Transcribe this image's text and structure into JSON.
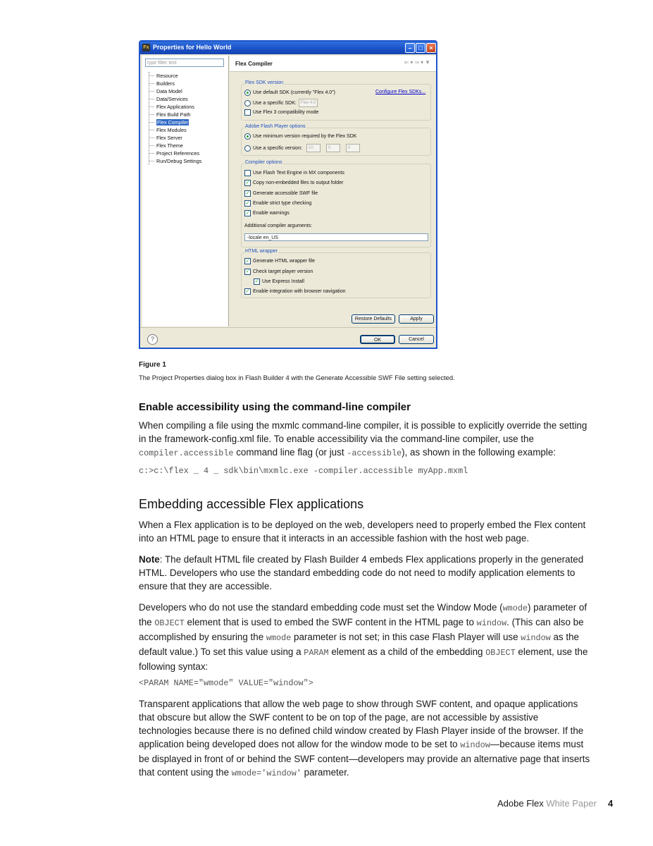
{
  "dialog": {
    "title": "Properties for Hello World",
    "app_icon": "Fx",
    "filter_placeholder": "type filter text",
    "tree_items": [
      "Resource",
      "Builders",
      "Data Model",
      "Data/Services",
      "Flex Applications",
      "Flex Build Path",
      "Flex Compiler",
      "Flex Modules",
      "Flex Server",
      "Flex Theme",
      "Project References",
      "Run/Debug Settings"
    ],
    "selected_item": "Flex Compiler",
    "page_title": "Flex Compiler",
    "sdk_group": {
      "label": "Flex SDK version",
      "use_default": "Use default SDK (currently \"Flex 4.0\")",
      "configure_link": "Configure Flex SDKs...",
      "use_specific": "Use a specific SDK:",
      "specific_value": "Flex 4.0",
      "flex3": "Use Flex 3 compatibility mode"
    },
    "player_group": {
      "label": "Adobe Flash Player options",
      "use_min": "Use minimum version required by the Flex SDK",
      "use_specific": "Use a specific version:",
      "v1": "10",
      "v2": "0",
      "v3": "0"
    },
    "compiler_group": {
      "label": "Compiler options",
      "opt1": "Use Flash Text Engine in MX components",
      "opt2": "Copy non-embedded files to output folder",
      "opt3": "Generate accessible SWF file",
      "opt4": "Enable strict type checking",
      "opt5": "Enable warnings",
      "args_label": "Additional compiler arguments:",
      "args_value": "-locale en_US"
    },
    "wrapper_group": {
      "label": "HTML wrapper",
      "opt1": "Generate HTML wrapper file",
      "opt2": "Check target player version",
      "opt3": "Use Express Install",
      "opt4": "Enable integration with browser navigation"
    },
    "restore_defaults": "Restore Defaults",
    "apply": "Apply",
    "ok": "OK",
    "cancel": "Cancel",
    "help_icon": "?"
  },
  "figure": {
    "label": "Figure 1",
    "caption": "The Project Properties dialog box in Flash Builder 4 with the Generate Accessible SWF File setting selected."
  },
  "section1": {
    "heading": "Enable accessibility using the command-line compiler",
    "p1_a": "When compiling a file using the mxmlc command-line compiler, it is possible to explicitly override the setting in the framework-config.xml file. To enable accessibility via the command-line compiler, use the ",
    "p1_code1": "compiler.accessible",
    "p1_b": " command line flag (or just ",
    "p1_code2": "-accessible",
    "p1_c": "), as shown in the following example:",
    "code": "c:>c:\\flex _ 4 _ sdk\\bin\\mxmlc.exe -compiler.accessible myApp.mxml"
  },
  "section2": {
    "heading": "Embedding accessible Flex applications",
    "p1": "When a Flex application is to be deployed on the web, developers need to properly embed the Flex content into an HTML page to ensure that it interacts in an accessible fashion with the host web page.",
    "note_label": "Note",
    "note_text": ": The default HTML file created by Flash Builder 4 embeds Flex applications properly in the generated HTML. Developers who use the standard embedding code do not need to modify application elements to ensure that they are accessible.",
    "p3_a": "Developers who do not use the standard embedding code must set the Window Mode (",
    "p3_c1": "wmode",
    "p3_b": ") parameter of the ",
    "p3_c2": "OBJECT",
    "p3_c": " element that is used to embed the SWF content in the HTML page to ",
    "p3_c3": "window",
    "p3_d": ". (This can also be accomplished by ensuring the ",
    "p3_c4": "wmode",
    "p3_e": " parameter is not set; in this case Flash Player will use ",
    "p3_c5": "window",
    "p3_f": " as the default value.) To set this value using a ",
    "p3_c6": "PARAM",
    "p3_g": " element as a child of the embedding ",
    "p3_c7": "OBJECT",
    "p3_h": " element, use the following syntax:",
    "code": "<PARAM NAME=\"wmode\" VALUE=\"window\">",
    "p4_a": "Transparent applications that allow the web page to show through SWF content, and opaque applications that obscure but allow the SWF content to be on top of the page, are not accessible by assistive technologies because there is no defined child window created by Flash Player inside of the browser. If the application being developed does not allow for the window mode to be set to ",
    "p4_c1": "window",
    "p4_b": "—because items must be displayed in front of or behind the SWF content—developers may provide an alternative page that inserts that content using the ",
    "p4_c2": "wmode='window'",
    "p4_c": " parameter."
  },
  "footer": {
    "brand": "Adobe Flex",
    "doc_type": "White Paper",
    "page": "4"
  }
}
